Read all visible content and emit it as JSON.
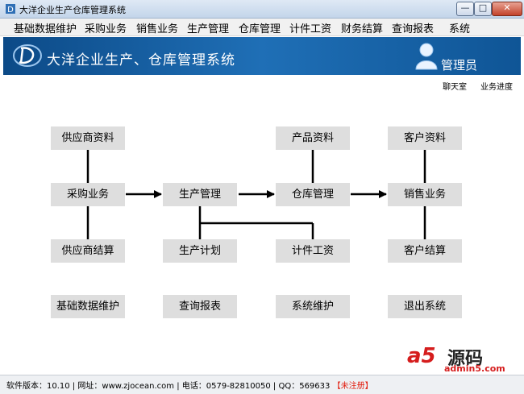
{
  "window": {
    "title": "大洋企业生产仓库管理系统",
    "controls": {
      "minimize": "—",
      "maximize": "□",
      "close": "✕"
    }
  },
  "menu": [
    "基础数据维护",
    "采购业务",
    "销售业务",
    "生产管理",
    "仓库管理",
    "计件工资",
    "财务结算",
    "查询报表",
    "系统"
  ],
  "banner": {
    "title": "大洋企业生产、仓库管理系统",
    "user": "管理员",
    "colors": {
      "banner": "#1a64a8",
      "accent_red": "#e21f10"
    }
  },
  "links": {
    "chat": "聊天室",
    "progress": "业务进度"
  },
  "flow": {
    "supplier_info": "供应商资料",
    "purchase": "采购业务",
    "supplier_settlement": "供应商结算",
    "production_mgmt": "生产管理",
    "production_plan": "生产计划",
    "product_info": "产品资料",
    "warehouse_mgmt": "仓库管理",
    "piecework_wage": "计件工资",
    "customer_info": "客户资料",
    "sales": "销售业务",
    "customer_settlement": "客户结算",
    "basic_data": "基础数据维护",
    "query_report": "查询报表",
    "system_maint": "系统维护",
    "exit": "退出系统"
  },
  "status": {
    "version": "软件版本：10.10",
    "website": "网址：www.zjocean.com",
    "phone": "电话：0579-82810050",
    "qq": "QQ：569633",
    "registration": "【未注册】",
    "sep": "|"
  },
  "watermark": {
    "logo": "a5",
    "name": "源码",
    "url": "admin5.com"
  }
}
